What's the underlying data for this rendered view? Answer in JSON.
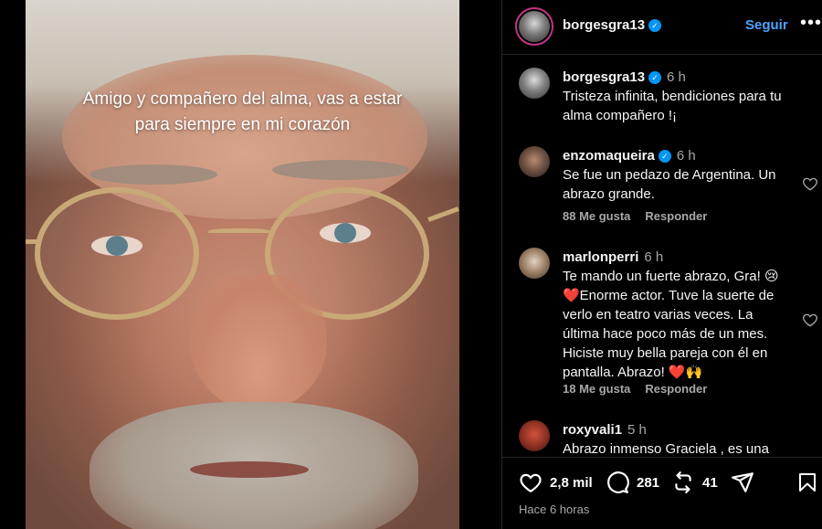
{
  "story": {
    "caption": "Amigo y compañero del alma, vas a estar para siempre en mi corazón"
  },
  "post": {
    "author": "borgesgra13",
    "follow_label": "Seguir",
    "more_label": "•••",
    "caption_time": "6 h",
    "caption_text": "Tristeza infinita, bendiciones para tu alma compañero !¡"
  },
  "comments": [
    {
      "user": "enzomaqueira",
      "verified": true,
      "time": "6 h",
      "text": "Se fue un pedazo de Argentina. Un abrazo grande.",
      "likes": "88 Me gusta",
      "reply": "Responder"
    },
    {
      "user": "marlonperri",
      "verified": false,
      "time": "6 h",
      "text": "Te mando un fuerte abrazo, Gra! 😢 ❤️Enorme actor. Tuve la suerte de verlo en teatro varias veces. La última hace poco más de un mes. Hiciste muy bella pareja con él en pantalla. Abrazo! ❤️🙌",
      "likes": "18 Me gusta",
      "reply": "Responder"
    },
    {
      "user": "roxyvali1",
      "verified": false,
      "time": "5 h",
      "text": "Abrazo inmenso Graciela , es una"
    }
  ],
  "actions": {
    "likes": "2,8 mil",
    "comments": "281",
    "reposts": "41",
    "timestamp": "Hace 6 horas"
  },
  "colors": {
    "accent": "#4fa3ff",
    "verified": "#0095f6",
    "muted": "#a8a8a8",
    "background": "#000000"
  },
  "icons": [
    "verified-badge-icon",
    "more-options-icon",
    "heart-icon",
    "comment-icon",
    "repost-icon",
    "share-icon",
    "bookmark-icon"
  ]
}
